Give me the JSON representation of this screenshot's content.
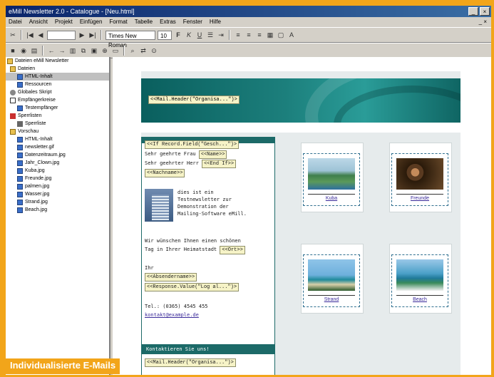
{
  "window": {
    "title": "eMill Newsletter 2.0 - Catalogue - [Neu.html]"
  },
  "menu": [
    "Datei",
    "Ansicht",
    "Projekt",
    "Einfügen",
    "Format",
    "Tabelle",
    "Extras",
    "Fenster",
    "Hilfe"
  ],
  "toolbar": {
    "font": "Times New Roman",
    "size": "10"
  },
  "tree": [
    {
      "label": "Dateien",
      "icon": "folder-icon"
    },
    {
      "label": "HTML-Inhalt",
      "icon": "file-icon"
    },
    {
      "label": "Ressourcen",
      "icon": "file-icon"
    },
    {
      "label": "Globales Skript",
      "icon": "gear-icon"
    },
    {
      "label": "Empfängerkreise",
      "icon": "monitor-icon"
    },
    {
      "label": "Testempfänger",
      "icon": "file-icon"
    },
    {
      "label": "Sperrlisten",
      "icon": "red-icon"
    },
    {
      "label": "Sperrliste",
      "icon": "lock-icon"
    },
    {
      "label": "Vorschau",
      "icon": "folder-icon"
    },
    {
      "label": "HTML-Inhalt",
      "icon": "file-icon"
    },
    {
      "label": "newsletter.gif",
      "icon": "file-icon"
    },
    {
      "label": "Datenzeitraum.jpg",
      "icon": "file-icon"
    },
    {
      "label": "Jahr_Clown.jpg",
      "icon": "file-icon"
    },
    {
      "label": "Kuba.jpg",
      "icon": "file-icon"
    },
    {
      "label": "Freunde.jpg",
      "icon": "file-icon"
    },
    {
      "label": "palmen.jpg",
      "icon": "file-icon"
    },
    {
      "label": "Wasser.jpg",
      "icon": "file-icon"
    },
    {
      "label": "Strand.jpg",
      "icon": "file-icon"
    },
    {
      "label": "Beach.jpg",
      "icon": "file-icon"
    }
  ],
  "editor": {
    "header_tag": "<<Mail.Header(\"Organisa...\")>",
    "salutation_tag": "<<If Record.Field(\"Gesch...\")>",
    "sehr_frau": "Sehr geehrte Frau",
    "name_tag": "<<Name>>",
    "sehr_herr": "Sehr geehrter Herr",
    "else_tag": "<<End If>>",
    "name2_tag": "<<Nachname>>",
    "body": [
      "dies ist ein",
      "Testnewsletter zur",
      "Demonstration der",
      "Mailing-Software eMill."
    ],
    "wish": "Wir wünschen Ihnen einen schönen",
    "wish2": "Tag in Ihrer Heimatstadt",
    "city_tag": "<<Ort>>",
    "ihr": "Ihr",
    "sender_tag": "<<Absendername>>",
    "sig_tag": "<<Response.Value(\"Log al...\")>",
    "tel": "Tel.: (0365) 4545 455",
    "email": "kontakt@example.de",
    "kontakt": "Kontaktieren Sie uns!",
    "footer_tag": "<<Mail.Header(\"Organisa...\")>"
  },
  "gallery": [
    {
      "label": "Kuba",
      "photo": "p1"
    },
    {
      "label": "Freunde",
      "photo": "p2"
    },
    {
      "label": "Strand",
      "photo": "p3"
    },
    {
      "label": "Beach",
      "photo": "p4"
    }
  ],
  "caption": "Individualisierte E-Mails"
}
